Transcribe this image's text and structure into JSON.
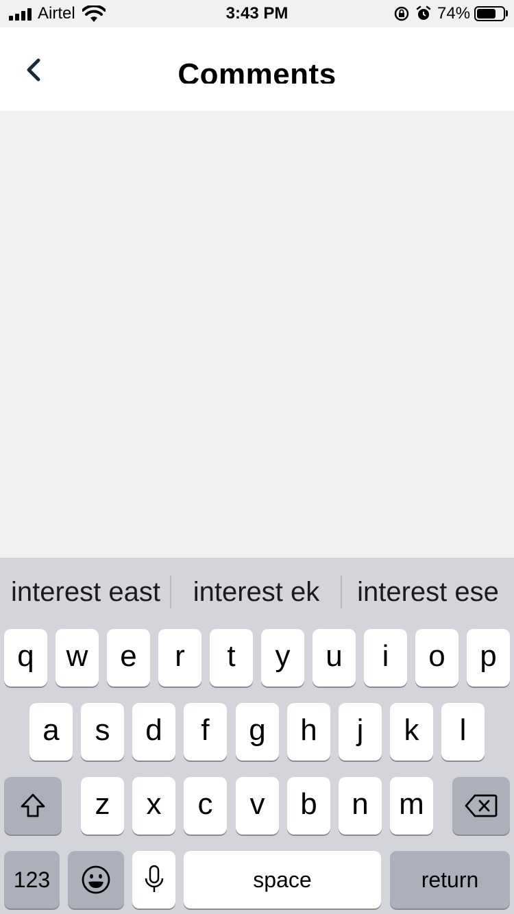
{
  "status_bar": {
    "carrier": "Airtel",
    "time": "3:43 PM",
    "battery_percent": "74%",
    "battery_level": 0.74
  },
  "nav": {
    "title": "Comments",
    "back_icon": "chevron-left-icon"
  },
  "keyboard": {
    "suggestions": [
      "interest east",
      "interest ek",
      "interest ese"
    ],
    "row1": [
      "q",
      "w",
      "e",
      "r",
      "t",
      "y",
      "u",
      "i",
      "o",
      "p"
    ],
    "row2": [
      "a",
      "s",
      "d",
      "f",
      "g",
      "h",
      "j",
      "k",
      "l"
    ],
    "row3": [
      "z",
      "x",
      "c",
      "v",
      "b",
      "n",
      "m"
    ],
    "numbers_label": "123",
    "space_label": "space",
    "return_label": "return",
    "icons": {
      "shift": "shift-arrow-icon",
      "delete": "backspace-icon",
      "emoji": "emoji-icon",
      "mic": "microphone-icon"
    }
  }
}
